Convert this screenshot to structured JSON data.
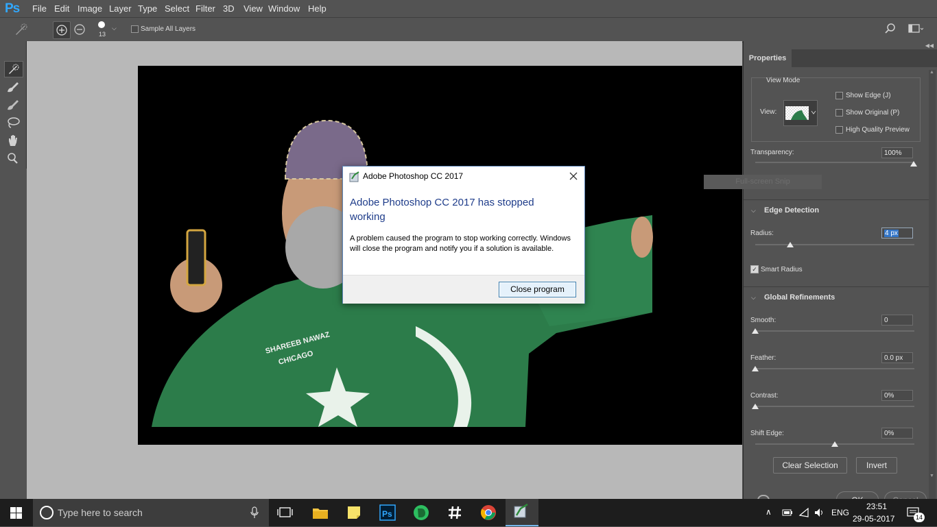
{
  "app": {
    "logo": "Ps"
  },
  "menu": [
    "File",
    "Edit",
    "Image",
    "Layer",
    "Type",
    "Select",
    "Filter",
    "3D",
    "View",
    "Window",
    "Help"
  ],
  "options_bar": {
    "brush_size": "13",
    "sample_all_layers": "Sample All Layers"
  },
  "properties": {
    "tab": "Properties",
    "view_mode": {
      "title": "View Mode",
      "view_label": "View:",
      "show_edge": "Show Edge (J)",
      "show_original": "Show Original (P)",
      "high_quality": "High Quality Preview"
    },
    "transparency": {
      "label": "Transparency:",
      "value": "100%",
      "fraction": 1.0
    },
    "ghost_text": "Full-screen Snip",
    "edge_detection": {
      "title": "Edge Detection",
      "radius_label": "Radius:",
      "radius_value": "4 px",
      "radius_fraction": 0.2,
      "smart_radius": "Smart Radius"
    },
    "global_refinements": {
      "title": "Global Refinements",
      "smooth": {
        "label": "Smooth:",
        "value": "0",
        "fraction": 0
      },
      "feather": {
        "label": "Feather:",
        "value": "0.0 px",
        "fraction": 0
      },
      "contrast": {
        "label": "Contrast:",
        "value": "0%",
        "fraction": 0
      },
      "shift_edge": {
        "label": "Shift Edge:",
        "value": "0%",
        "fraction": 0.5
      }
    },
    "clear_selection": "Clear Selection",
    "invert": "Invert",
    "ok": "OK",
    "cancel": "Cancel"
  },
  "dialog": {
    "title": "Adobe Photoshop CC 2017",
    "heading": "Adobe Photoshop CC 2017 has stopped working",
    "body": "A problem caused the program to stop working correctly. Windows will close the program and notify you if a solution is available.",
    "button": "Close program"
  },
  "image_text": {
    "line1": "SHAREEB NAWAZ",
    "line2": "CHICAGO"
  },
  "taskbar": {
    "search_placeholder": "Type here to search",
    "language": "ENG",
    "time": "23:51",
    "date": "29-05-2017",
    "notifications": "14"
  },
  "colors": {
    "accent": "#31a8ff",
    "dialog_heading": "#1e3c8a",
    "shirt": "#2c7c4a"
  }
}
